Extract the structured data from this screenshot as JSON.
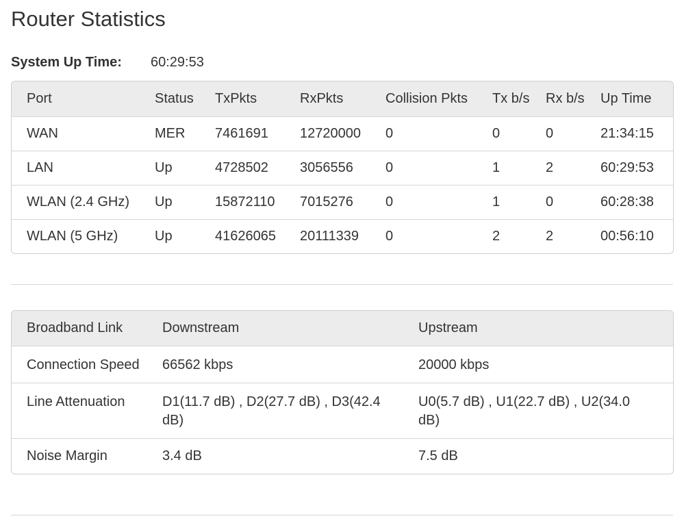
{
  "page": {
    "title": "Router Statistics"
  },
  "system": {
    "uptime_label": "System Up Time:",
    "uptime_value": "60:29:53"
  },
  "ports_table": {
    "headers": [
      "Port",
      "Status",
      "TxPkts",
      "RxPkts",
      "Collision Pkts",
      "Tx b/s",
      "Rx b/s",
      "Up Time"
    ],
    "rows": [
      [
        "WAN",
        "MER",
        "7461691",
        "12720000",
        "0",
        "0",
        "0",
        "21:34:15"
      ],
      [
        "LAN",
        "Up",
        "4728502",
        "3056556",
        "0",
        "1",
        "2",
        "60:29:53"
      ],
      [
        "WLAN (2.4 GHz)",
        "Up",
        "15872110",
        "7015276",
        "0",
        "1",
        "0",
        "60:28:38"
      ],
      [
        "WLAN (5 GHz)",
        "Up",
        "41626065",
        "20111339",
        "0",
        "2",
        "2",
        "00:56:10"
      ]
    ]
  },
  "broadband_table": {
    "headers": [
      "Broadband Link",
      "Downstream",
      "Upstream"
    ],
    "rows": [
      [
        "Connection Speed",
        "66562 kbps",
        "20000 kbps"
      ],
      [
        "Line Attenuation",
        "D1(11.7 dB) , D2(27.7 dB) , D3(42.4 dB)",
        "U0(5.7 dB) , U1(22.7 dB) , U2(34.0 dB)"
      ],
      [
        "Noise Margin",
        "3.4 dB",
        "7.5 dB"
      ]
    ]
  }
}
